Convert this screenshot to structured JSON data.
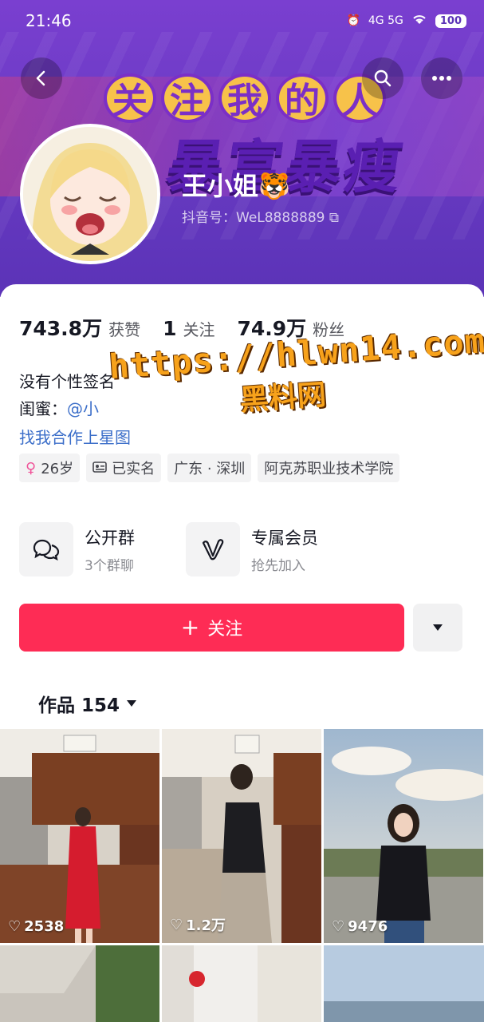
{
  "status_bar": {
    "time": "21:46",
    "network": "4G 5G",
    "battery": "100"
  },
  "header": {
    "banner_line1": [
      "关",
      "注",
      "我",
      "的",
      "人"
    ],
    "banner_line2": "暴富暴瘦",
    "nickname": "王小姐🐯",
    "douyin_id": "抖音号：WeL8888889"
  },
  "stats": [
    {
      "num": "743.8万",
      "label": "获赞"
    },
    {
      "num": "1",
      "label": "关注"
    },
    {
      "num": "74.9万",
      "label": "粉丝"
    }
  ],
  "bio": {
    "line1": "没有个性签名",
    "line2_prefix": "闺蜜：",
    "line2_mention": "@小",
    "link": "找我合作上星图"
  },
  "watermark": {
    "url": "https://hlwn14.com",
    "name": "黑料网"
  },
  "tags": [
    {
      "icon": "female-icon",
      "text": "26岁"
    },
    {
      "icon": "id-card-icon",
      "text": "已实名"
    },
    {
      "icon": "",
      "text": "广东 · 深圳"
    },
    {
      "icon": "",
      "text": "阿克苏职业技术学院"
    }
  ],
  "features": [
    {
      "title": "公开群",
      "sub": "3个群聊"
    },
    {
      "title": "专属会员",
      "sub": "抢先加入"
    }
  ],
  "follow_label": "关注",
  "works_tab": "作品 154",
  "videos": [
    {
      "likes": "2538"
    },
    {
      "likes": "1.2万"
    },
    {
      "likes": "9476"
    }
  ],
  "colors": {
    "accent": "#fe2c55",
    "link": "#3b6ec9",
    "banner": "#6a3bc4"
  }
}
